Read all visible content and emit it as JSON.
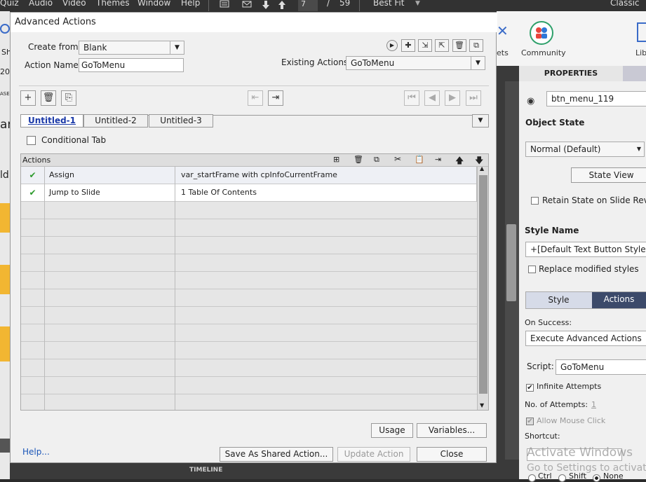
{
  "menubar": {
    "items": [
      "Quiz",
      "Audio",
      "Video",
      "Themes",
      "Window",
      "Help"
    ],
    "current_slide": "7",
    "slide_sep": "/",
    "total_slides": "59",
    "fit": "Best Fit",
    "workspace": "Classic"
  },
  "topright": {
    "assets_label": "ets",
    "community_label": "Community",
    "library_label": "Lib"
  },
  "left_strip": {
    "fragments": [
      "Sh",
      "20",
      "ASE",
      "ar",
      "ld"
    ]
  },
  "dialog": {
    "title": "Advanced Actions",
    "create_from_label": "Create from:",
    "create_from_value": "Blank",
    "action_name_label": "Action Name:",
    "action_name_value": "GoToMenu",
    "existing_actions_label": "Existing Actions:",
    "existing_actions_value": "GoToMenu",
    "tabs": [
      "Untitled-1",
      "Untitled-2",
      "Untitled-3"
    ],
    "conditional_tab_label": "Conditional Tab",
    "actions_header": "Actions",
    "rows": [
      {
        "action": "Assign",
        "detail": "var_startFrame   with   cpInfoCurrentFrame"
      },
      {
        "action": "Jump to Slide",
        "detail": "1 Table Of Contents"
      }
    ],
    "usage_label": "Usage",
    "variables_label": "Variables...",
    "help_label": "Help...",
    "save_shared_label": "Save As Shared Action...",
    "update_label": "Update Action",
    "close_label": "Close"
  },
  "properties": {
    "tab_label": "PROPERTIES",
    "object_name": "btn_menu_119",
    "object_state_label": "Object State",
    "object_state_value": "Normal (Default)",
    "state_view_label": "State View",
    "retain_state_label": "Retain State on Slide Revisit",
    "style_name_label": "Style Name",
    "style_name_value": "+[Default Text Button Style]",
    "replace_styles_label": "Replace modified styles",
    "style_tab": "Style",
    "actions_tab": "Actions",
    "on_success_label": "On Success:",
    "on_success_value": "Execute Advanced Actions",
    "script_label": "Script:",
    "script_value": "GoToMenu",
    "infinite_attempts_label": "Infinite Attempts",
    "attempts_label": "No. of Attempts:",
    "attempts_value": "1",
    "allow_mouse_label": "Allow Mouse Click",
    "shortcut_label": "Shortcut:",
    "ctrl_label": "Ctrl",
    "shift_label": "Shift",
    "none_label": "None"
  },
  "timeline_label": "TIMELINE",
  "watermark": {
    "line1": "Activate Windows",
    "line2": "Go to Settings to activate"
  },
  "colors": {
    "accent_tab": "#1c3aa8",
    "actions_tab_bg": "#3c4a6a",
    "check_green": "#2c9a2c"
  }
}
